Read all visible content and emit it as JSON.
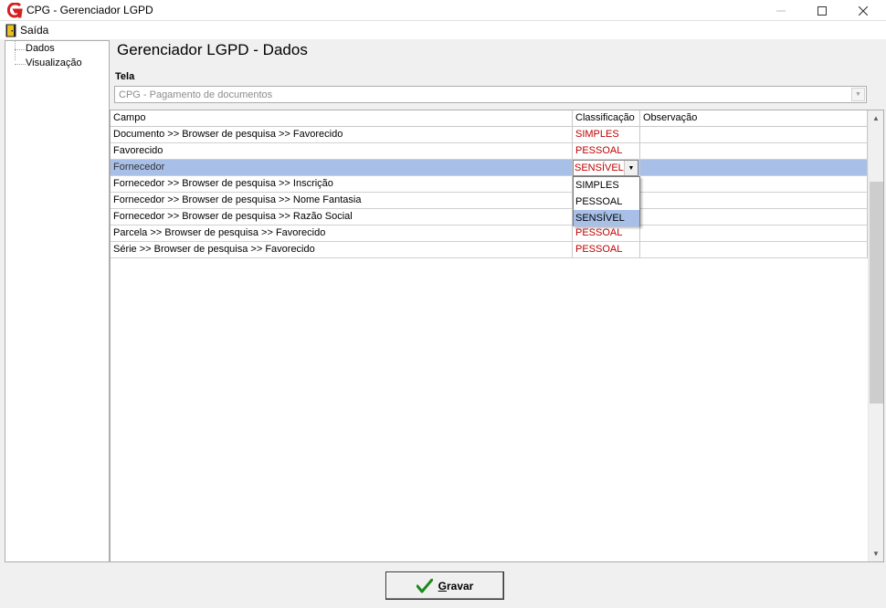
{
  "window": {
    "title": "CPG - Gerenciador LGPD",
    "icon": "app-logo-icon",
    "controls": [
      "minimize-icon",
      "maximize-icon",
      "close-icon"
    ]
  },
  "menu": {
    "exit_label": "Saída",
    "exit_icon": "exit-door-icon"
  },
  "sidebar": {
    "items": [
      {
        "label": "Dados"
      },
      {
        "label": "Visualização"
      }
    ]
  },
  "main": {
    "title": "Gerenciador LGPD - Dados",
    "tela_label": "Tela",
    "tela_value": "CPG - Pagamento de documentos"
  },
  "grid": {
    "columns": {
      "campo": "Campo",
      "classificacao": "Classificação",
      "observacao": "Observação"
    },
    "rows": [
      {
        "campo": "Documento >> Browser de pesquisa >> Favorecido",
        "classificacao": "SIMPLES",
        "observacao": ""
      },
      {
        "campo": "Favorecido",
        "classificacao": "PESSOAL",
        "observacao": ""
      },
      {
        "campo": "Fornecedor",
        "classificacao": "SENSÍVEL",
        "observacao": ""
      },
      {
        "campo": "Fornecedor >> Browser de pesquisa >> Inscrição",
        "classificacao": "",
        "observacao": ""
      },
      {
        "campo": "Fornecedor >> Browser de pesquisa >> Nome Fantasia",
        "classificacao": "",
        "observacao": ""
      },
      {
        "campo": "Fornecedor >> Browser de pesquisa >> Razão Social",
        "classificacao": "",
        "observacao": ""
      },
      {
        "campo": "Parcela >> Browser de pesquisa >> Favorecido",
        "classificacao": "PESSOAL",
        "observacao": ""
      },
      {
        "campo": "Série >> Browser de pesquisa >> Favorecido",
        "classificacao": "PESSOAL",
        "observacao": ""
      }
    ],
    "selected_row": 2,
    "editor_value": "SENSÍVEL",
    "dropdown_options": [
      "SIMPLES",
      "PESSOAL",
      "SENSÍVEL"
    ],
    "dropdown_highlighted": "SENSÍVEL"
  },
  "footer": {
    "save_label_underlined": "G",
    "save_label_rest": "ravar",
    "save_icon": "checkmark-icon"
  },
  "colors": {
    "classification_text": "#c00000",
    "selection": "#a8c0e8"
  }
}
